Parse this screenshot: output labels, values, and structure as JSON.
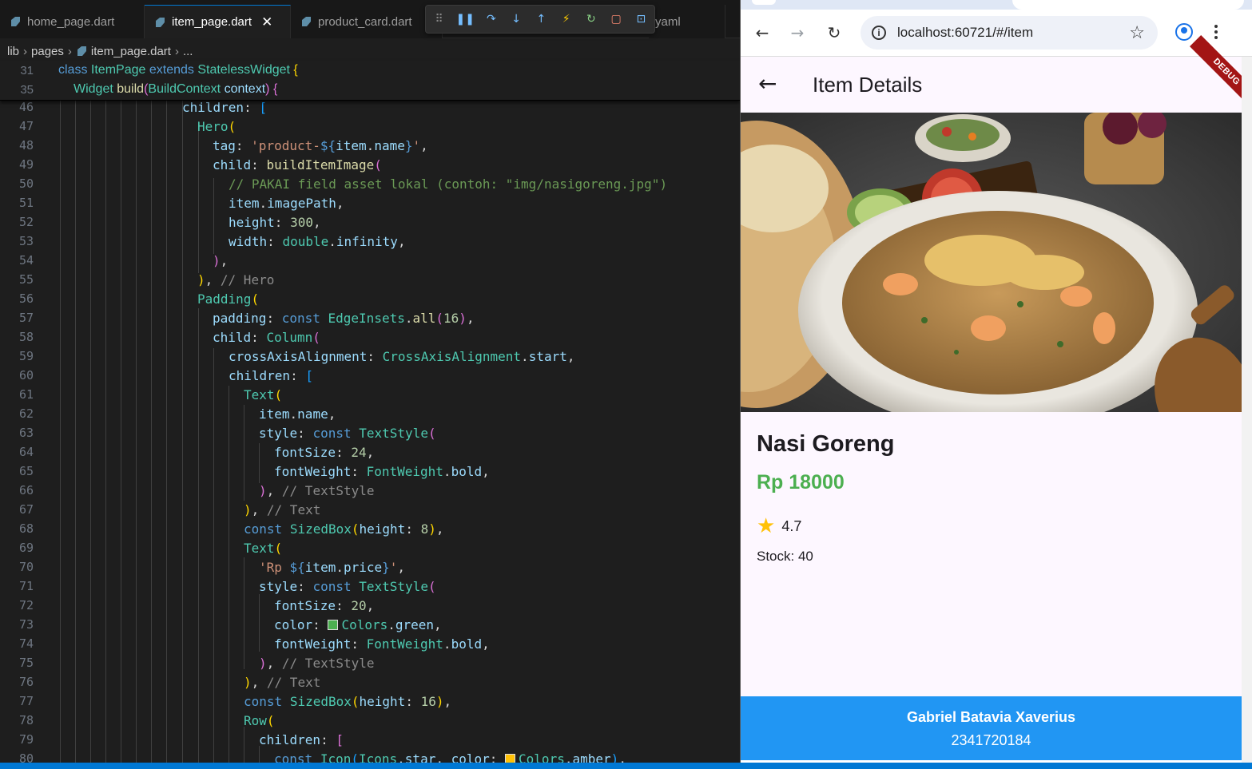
{
  "editor": {
    "tabs": [
      {
        "label": "home_page.dart"
      },
      {
        "label": "item_page.dart"
      },
      {
        "label": "product_card.dart"
      },
      {
        "label": "yaml"
      }
    ],
    "close_glyph": "✕",
    "breadcrumb": [
      "lib",
      "pages",
      "item_page.dart",
      "..."
    ],
    "sticky": [
      {
        "num": "31",
        "text": "class ItemPage extends StatelessWidget {"
      },
      {
        "num": "35",
        "text": "Widget build(BuildContext context) {"
      }
    ],
    "lines": [
      {
        "num": "46",
        "text": "children: ["
      },
      {
        "num": "47",
        "text": "Hero("
      },
      {
        "num": "48",
        "text": "tag: 'product-${item.name}',"
      },
      {
        "num": "49",
        "text": "child: buildItemImage("
      },
      {
        "num": "50",
        "text": "// PAKAI field asset lokal (contoh: \"img/nasigoreng.jpg\")"
      },
      {
        "num": "51",
        "text": "item.imagePath,"
      },
      {
        "num": "52",
        "text": "height: 300,"
      },
      {
        "num": "53",
        "text": "width: double.infinity,"
      },
      {
        "num": "54",
        "text": "),"
      },
      {
        "num": "55",
        "text": "), // Hero"
      },
      {
        "num": "56",
        "text": "Padding("
      },
      {
        "num": "57",
        "text": "padding: const EdgeInsets.all(16),"
      },
      {
        "num": "58",
        "text": "child: Column("
      },
      {
        "num": "59",
        "text": "crossAxisAlignment: CrossAxisAlignment.start,"
      },
      {
        "num": "60",
        "text": "children: ["
      },
      {
        "num": "61",
        "text": "Text("
      },
      {
        "num": "62",
        "text": "item.name,"
      },
      {
        "num": "63",
        "text": "style: const TextStyle("
      },
      {
        "num": "64",
        "text": "fontSize: 24,"
      },
      {
        "num": "65",
        "text": "fontWeight: FontWeight.bold,"
      },
      {
        "num": "66",
        "text": "), // TextStyle"
      },
      {
        "num": "67",
        "text": "), // Text"
      },
      {
        "num": "68",
        "text": "const SizedBox(height: 8),"
      },
      {
        "num": "69",
        "text": "Text("
      },
      {
        "num": "70",
        "text": "'Rp ${item.price}',"
      },
      {
        "num": "71",
        "text": "style: const TextStyle("
      },
      {
        "num": "72",
        "text": "fontSize: 20,"
      },
      {
        "num": "73",
        "text": "color: Colors.green,"
      },
      {
        "num": "74",
        "text": "fontWeight: FontWeight.bold,"
      },
      {
        "num": "75",
        "text": "), // TextStyle"
      },
      {
        "num": "76",
        "text": "), // Text"
      },
      {
        "num": "77",
        "text": "const SizedBox(height: 16),"
      },
      {
        "num": "78",
        "text": "Row("
      },
      {
        "num": "79",
        "text": "children: ["
      },
      {
        "num": "80",
        "text": "const Icon(Icons.star, color: Colors.amber),"
      }
    ],
    "swatch_colors": {
      "green": "#4caf50",
      "amber": "#ffc107"
    }
  },
  "browser": {
    "url": "localhost:60721/#/item",
    "app_title": "Item Details",
    "debug_label": "DEBUG",
    "item": {
      "name": "Nasi Goreng",
      "price": "Rp 18000",
      "rating": "4.7",
      "stock": "Stock: 40"
    },
    "footer": {
      "name": "Gabriel Batavia Xaverius",
      "id": "2341720184"
    },
    "colors": {
      "primary": "#2196f3",
      "price": "#4caf50",
      "star": "#ffc107",
      "appbar": "#fdf7ff"
    }
  }
}
